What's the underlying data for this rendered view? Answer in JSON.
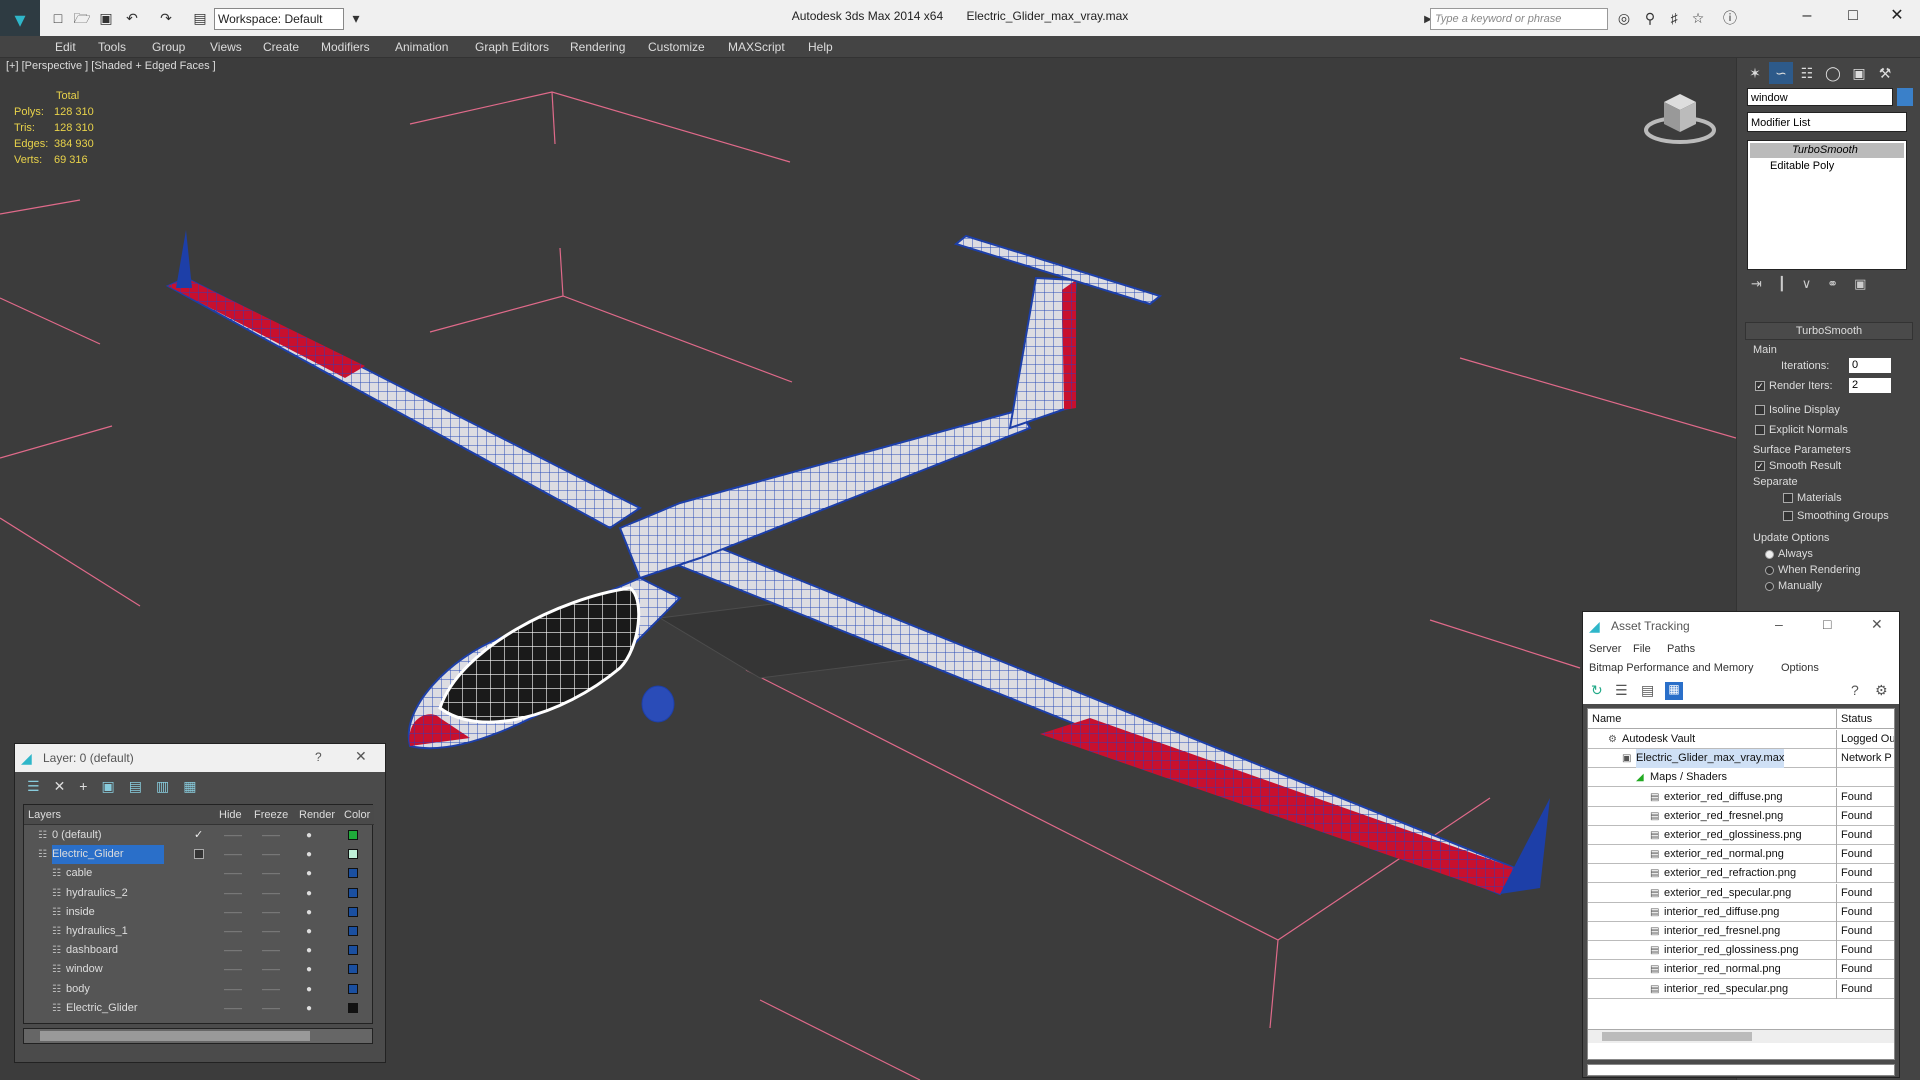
{
  "app": {
    "title": "Autodesk 3ds Max  2014 x64",
    "file": "Electric_Glider_max_vray.max",
    "workspace": "Workspace: Default",
    "search_placeholder": "Type a keyword or phrase"
  },
  "menu": [
    "Edit",
    "Tools",
    "Group",
    "Views",
    "Create",
    "Modifiers",
    "Animation",
    "Graph Editors",
    "Rendering",
    "Customize",
    "MAXScript",
    "Help"
  ],
  "viewport": {
    "label": "[+] [Perspective ] [Shaded + Edged Faces ]",
    "stats_header": "Total",
    "stats": [
      {
        "label": "Polys:",
        "value": "128 310"
      },
      {
        "label": "Tris:",
        "value": "128 310"
      },
      {
        "label": "Edges:",
        "value": "384 930"
      },
      {
        "label": "Verts:",
        "value": "69 316"
      }
    ]
  },
  "command_panel": {
    "object_name": "window",
    "modifier_list": "Modifier List",
    "stack": [
      "TurboSmooth",
      "Editable Poly"
    ],
    "rollout_title": "TurboSmooth",
    "main_label": "Main",
    "iterations_label": "Iterations:",
    "iterations_value": "0",
    "render_iters_label": "Render Iters:",
    "render_iters_value": "2",
    "isoline": "Isoline Display",
    "explicit_normals": "Explicit Normals",
    "surface_params": "Surface Parameters",
    "smooth_result": "Smooth Result",
    "separate": "Separate",
    "materials": "Materials",
    "smoothing_groups": "Smoothing Groups",
    "update_options": "Update Options",
    "always": "Always",
    "when_rendering": "When Rendering",
    "manually": "Manually"
  },
  "layer_panel": {
    "title": "Layer: 0 (default)",
    "help": "?",
    "headers": [
      "Layers",
      "Hide",
      "Freeze",
      "Render",
      "Color"
    ],
    "rows": [
      {
        "name": "0 (default)",
        "color": "#1faa3a"
      },
      {
        "name": "Electric_Glider",
        "color": "#bff0d8"
      },
      {
        "name": "cable",
        "color": "#1a4fa0"
      },
      {
        "name": "hydraulics_2",
        "color": "#1a4fa0"
      },
      {
        "name": "inside",
        "color": "#1a4fa0"
      },
      {
        "name": "hydraulics_1",
        "color": "#1a4fa0"
      },
      {
        "name": "dashboard",
        "color": "#1a4fa0"
      },
      {
        "name": "window",
        "color": "#1a4fa0"
      },
      {
        "name": "body",
        "color": "#1a4fa0"
      },
      {
        "name": "Electric_Glider",
        "color": "#111111"
      }
    ]
  },
  "asset_panel": {
    "title": "Asset Tracking",
    "menu1": [
      "Server",
      "File",
      "Paths"
    ],
    "menu2": [
      "Bitmap Performance and Memory",
      "Options"
    ],
    "col_name": "Name",
    "col_status": "Status",
    "rows": [
      {
        "name": "Autodesk Vault",
        "status": "Logged Ou"
      },
      {
        "name": "Electric_Glider_max_vray.max",
        "status": "Network P"
      },
      {
        "name": "Maps / Shaders",
        "status": ""
      },
      {
        "name": "exterior_red_diffuse.png",
        "status": "Found"
      },
      {
        "name": "exterior_red_fresnel.png",
        "status": "Found"
      },
      {
        "name": "exterior_red_glossiness.png",
        "status": "Found"
      },
      {
        "name": "exterior_red_normal.png",
        "status": "Found"
      },
      {
        "name": "exterior_red_refraction.png",
        "status": "Found"
      },
      {
        "name": "exterior_red_specular.png",
        "status": "Found"
      },
      {
        "name": "interior_red_diffuse.png",
        "status": "Found"
      },
      {
        "name": "interior_red_fresnel.png",
        "status": "Found"
      },
      {
        "name": "interior_red_glossiness.png",
        "status": "Found"
      },
      {
        "name": "interior_red_normal.png",
        "status": "Found"
      },
      {
        "name": "interior_red_specular.png",
        "status": "Found"
      }
    ]
  }
}
